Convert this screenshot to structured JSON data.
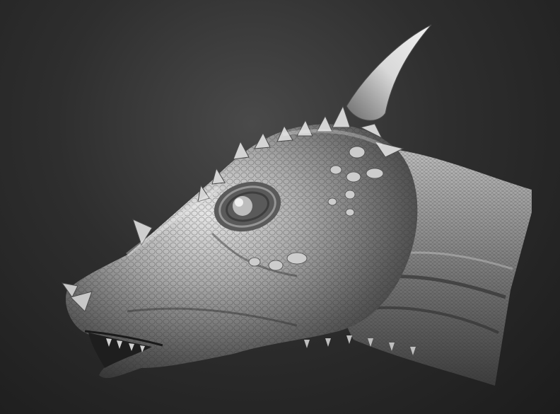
{
  "scene": {
    "subject": "sculpted-dinosaur-head",
    "render_style": "grey-matcap",
    "colors": {
      "background_center": "#4a4a4a",
      "background_edge": "#1c1c1c",
      "surface_light": "#e6e6e6",
      "surface_mid": "#9a9a9a",
      "surface_dark": "#3c3c3c"
    }
  }
}
